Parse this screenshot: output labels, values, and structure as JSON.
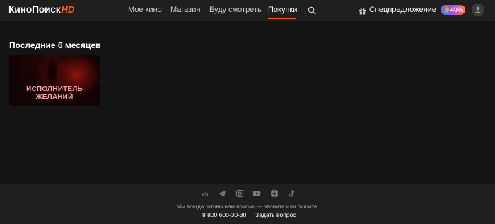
{
  "header": {
    "logo": {
      "text": "КиноПоиск",
      "suffix": "HD"
    },
    "nav": [
      {
        "label": "Мое кино"
      },
      {
        "label": "Магазин"
      },
      {
        "label": "Буду смотреть"
      },
      {
        "label": "Покупки",
        "active": true
      }
    ],
    "search_icon": "search-icon",
    "special_offer": {
      "icon": "gift-icon",
      "label": "Спецпредложение"
    },
    "plus_badge": {
      "icon": "plus-logo-icon",
      "label": "40%"
    },
    "avatar_icon": "user-icon"
  },
  "main": {
    "section_title": "Последние 6 месяцев",
    "items": [
      {
        "title_line1": "ИСПОЛНИТЕЛЬ",
        "title_line2": "ЖЕЛАНИЙ"
      }
    ]
  },
  "footer": {
    "social_icons": [
      "vk-icon",
      "telegram-icon",
      "instagram-icon",
      "youtube-icon",
      "odnoklassniki-icon",
      "tiktok-icon"
    ],
    "support_text": "Мы всегда готовы вам помочь — звоните или пишите.",
    "phone": "8 800 600-30-30",
    "ask_link": "Задать вопрос"
  },
  "colors": {
    "background": "#141414",
    "panel": "#1f1f1f",
    "accent": "#ff5c00"
  }
}
